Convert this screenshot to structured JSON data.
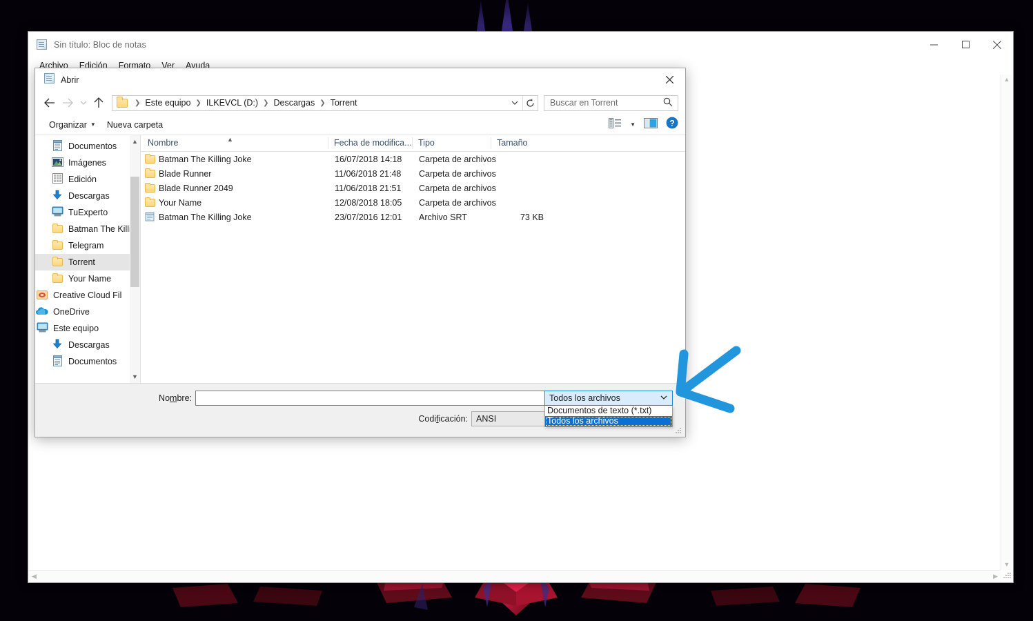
{
  "notepad": {
    "title": "Sin título: Bloc de notas",
    "icon": "notepad-icon",
    "menu": [
      "Archivo",
      "Edición",
      "Formato",
      "Ver",
      "Ayuda"
    ],
    "window_buttons": {
      "minimize": "minimize-icon",
      "maximize": "maximize-icon",
      "close": "close-icon"
    }
  },
  "dialog": {
    "title": "Abrir",
    "close_icon": "close-icon",
    "nav": {
      "back_icon": "arrow-left-icon",
      "forward_icon": "arrow-right-icon",
      "history_icon": "chevron-down-icon",
      "up_icon": "arrow-up-icon",
      "breadcrumbs": [
        "Este equipo",
        "ILKEVCL (D:)",
        "Descargas",
        "Torrent"
      ],
      "dropdown_icon": "chevron-down-icon",
      "refresh_icon": "refresh-icon"
    },
    "search": {
      "placeholder": "Buscar en Torrent",
      "icon": "search-icon"
    },
    "toolbar": {
      "organize_label": "Organizar",
      "new_folder_label": "Nueva carpeta",
      "view_icon": "view-list-icon",
      "view_caret_icon": "chevron-down-icon",
      "preview_pane_icon": "preview-pane-icon",
      "help_icon": "help-icon"
    },
    "sidebar": {
      "scroll_up_icon": "chevron-up-icon",
      "scroll_down_icon": "chevron-down-icon",
      "items": [
        {
          "label": "Documentos",
          "icon": "documents-icon",
          "pinned": true,
          "indent": 1,
          "selected": false
        },
        {
          "label": "Imágenes",
          "icon": "pictures-icon",
          "pinned": true,
          "indent": 1,
          "selected": false
        },
        {
          "label": "Edición",
          "icon": "grid-icon",
          "pinned": true,
          "indent": 1,
          "selected": false
        },
        {
          "label": "Descargas",
          "icon": "download-icon",
          "pinned": true,
          "indent": 1,
          "selected": false
        },
        {
          "label": "TuExperto",
          "icon": "computer-icon",
          "pinned": true,
          "indent": 1,
          "selected": false
        },
        {
          "label": "Batman The Killi",
          "icon": "folder-icon",
          "pinned": false,
          "indent": 1,
          "selected": false
        },
        {
          "label": "Telegram",
          "icon": "folder-icon",
          "pinned": false,
          "indent": 1,
          "selected": false
        },
        {
          "label": "Torrent",
          "icon": "folder-icon",
          "pinned": false,
          "indent": 1,
          "selected": true
        },
        {
          "label": "Your Name",
          "icon": "folder-icon",
          "pinned": false,
          "indent": 1,
          "selected": false
        },
        {
          "label": "Creative Cloud Fil",
          "icon": "creative-cloud-icon",
          "pinned": false,
          "indent": 0,
          "selected": false
        },
        {
          "label": "OneDrive",
          "icon": "onedrive-icon",
          "pinned": false,
          "indent": 0,
          "selected": false
        },
        {
          "label": "Este equipo",
          "icon": "computer-icon",
          "pinned": false,
          "indent": 0,
          "selected": false
        },
        {
          "label": "Descargas",
          "icon": "download-icon",
          "pinned": false,
          "indent": 1,
          "selected": false
        },
        {
          "label": "Documentos",
          "icon": "documents-icon",
          "pinned": false,
          "indent": 1,
          "selected": false
        }
      ]
    },
    "filelist": {
      "sort_indicator": "sort-ascending-icon",
      "columns": [
        "Nombre",
        "Fecha de modifica...",
        "Tipo",
        "Tamaño"
      ],
      "rows": [
        {
          "name": "Batman The Killing Joke",
          "date": "16/07/2018 14:18",
          "type": "Carpeta de archivos",
          "size": "",
          "icon": "folder-icon"
        },
        {
          "name": "Blade Runner",
          "date": "11/06/2018 21:48",
          "type": "Carpeta de archivos",
          "size": "",
          "icon": "folder-icon"
        },
        {
          "name": "Blade Runner 2049",
          "date": "11/06/2018 21:51",
          "type": "Carpeta de archivos",
          "size": "",
          "icon": "folder-icon"
        },
        {
          "name": "Your Name",
          "date": "12/08/2018 18:05",
          "type": "Carpeta de archivos",
          "size": "",
          "icon": "folder-icon"
        },
        {
          "name": "Batman The Killing Joke",
          "date": "23/07/2016 12:01",
          "type": "Archivo SRT",
          "size": "73 KB",
          "icon": "notepad-file-icon"
        }
      ]
    },
    "bottom": {
      "name_label_before": "No",
      "name_label_accel": "m",
      "name_label_after": "bre:",
      "name_value": "",
      "encoding_label_before": "Codi",
      "encoding_label_accel": "f",
      "encoding_label_after": "icación:",
      "encoding_value": "ANSI",
      "encoding_caret_icon": "chevron-down-icon",
      "filter_value": "Todos los archivos",
      "filter_caret_icon": "chevron-down-icon",
      "filter_options": [
        {
          "label": "Documentos de texto (*.txt)",
          "selected": false
        },
        {
          "label": "Todos los archivos",
          "selected": true
        }
      ],
      "resize_grip_icon": "resize-grip-icon"
    }
  },
  "annotation": {
    "arrow_icon": "hand-drawn-arrow-icon",
    "color": "#2196dd"
  },
  "colors": {
    "accent_blue": "#0b6fd4",
    "combo_border": "#1c88d8",
    "combo_fill": "#d9ecfb",
    "selection_grey": "#e5e5e5",
    "desktop": "#040208",
    "wallpaper_red": "#c8102e"
  }
}
